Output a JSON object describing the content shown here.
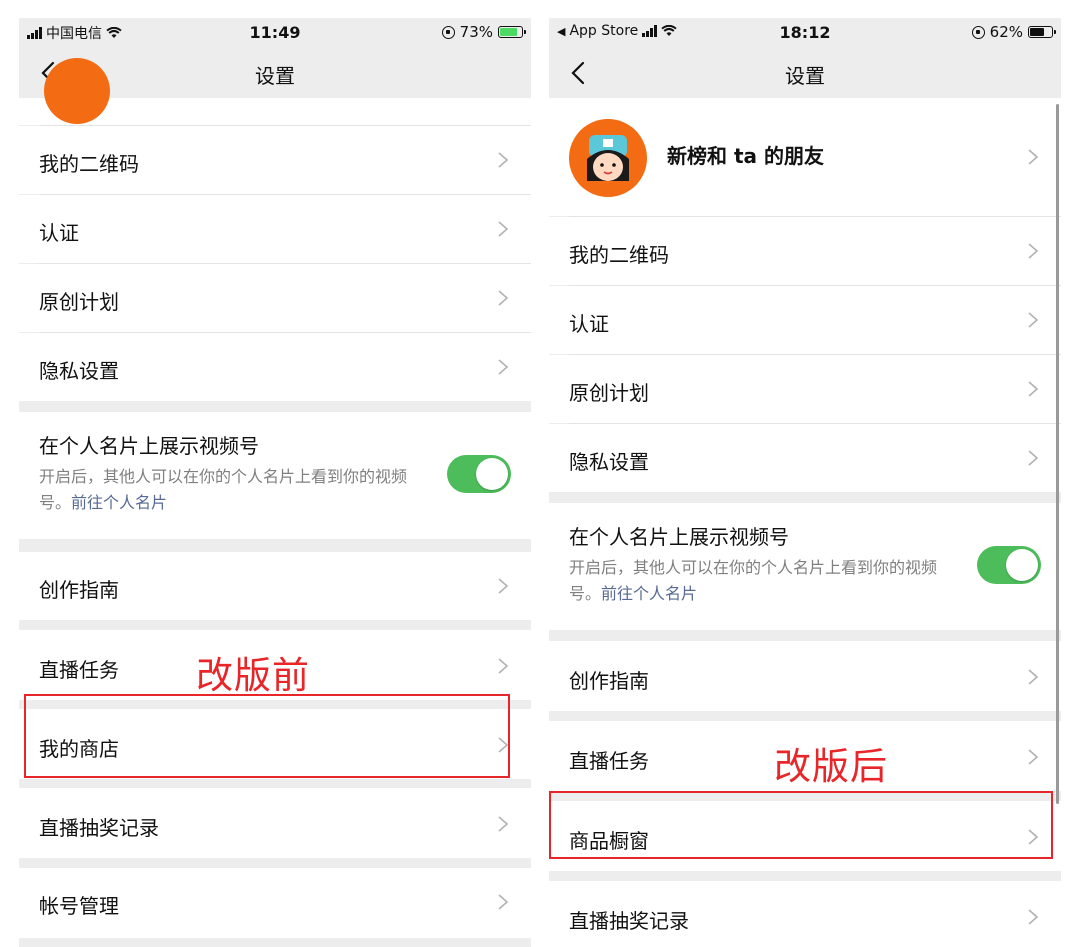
{
  "before": {
    "status": {
      "carrier": "中国电信",
      "time": "11:49",
      "battery": "73%"
    },
    "nav": {
      "title": "设置"
    },
    "items": {
      "qr": "我的二维码",
      "verify": "认证",
      "original": "原创计划",
      "privacy": "隐私设置",
      "showcase_title": "在个人名片上展示视频号",
      "showcase_desc": "开启后，其他人可以在你的个人名片上看到你的视频号。",
      "showcase_link": "前往个人名片",
      "guide": "创作指南",
      "live_tasks": "直播任务",
      "store": "我的商店",
      "lottery": "直播抽奖记录",
      "account": "帐号管理"
    },
    "annotation": "改版前",
    "toggle_on": true
  },
  "after": {
    "status": {
      "back_app": "App Store",
      "time": "18:12",
      "battery": "62%"
    },
    "nav": {
      "title": "设置"
    },
    "profile": {
      "name": "新榜和 ta 的朋友"
    },
    "items": {
      "qr": "我的二维码",
      "verify": "认证",
      "original": "原创计划",
      "privacy": "隐私设置",
      "showcase_title": "在个人名片上展示视频号",
      "showcase_desc": "开启后，其他人可以在你的个人名片上看到你的视频号。",
      "showcase_link": "前往个人名片",
      "guide": "创作指南",
      "live_tasks": "直播任务",
      "shop_window": "商品橱窗",
      "lottery": "直播抽奖记录"
    },
    "annotation": "改版后",
    "toggle_on": true
  },
  "colors": {
    "accent_red": "#e8262a",
    "toggle_green": "#4cbd5a",
    "link_blue": "#576b95"
  }
}
